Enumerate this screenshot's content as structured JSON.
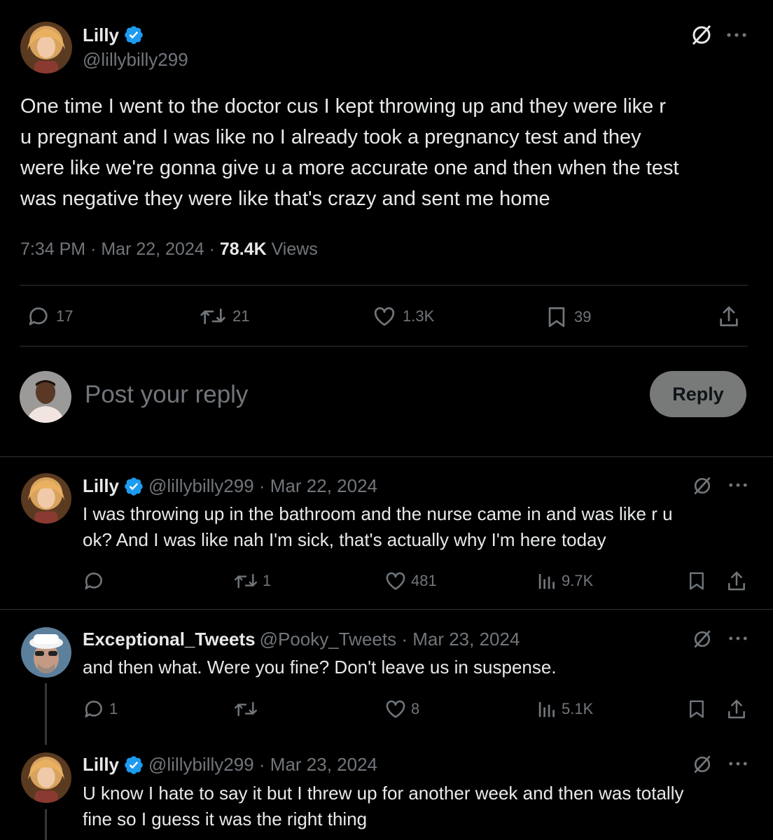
{
  "main_post": {
    "author_name": "Lilly",
    "author_handle": "@lillybilly299",
    "text_lines": [
      "One time I went to the doctor cus I kept throwing up and they were like r",
      "u pregnant and I was like no I already took a pregnancy test and they",
      "were like we're gonna give u a more accurate one and then when the test",
      "was negative they were like that's crazy and sent me home"
    ],
    "time": "7:34 PM",
    "separator": "·",
    "date": "Mar 22, 2024",
    "views_count": "78.4K",
    "views_label": "Views",
    "stats": {
      "replies": "17",
      "reposts": "21",
      "likes": "1.3K",
      "bookmarks": "39"
    }
  },
  "composer": {
    "placeholder": "Post your reply",
    "reply_button": "Reply"
  },
  "replies": [
    {
      "author_name": "Lilly",
      "handle_date": "@lillybilly299 · Mar 22, 2024",
      "text_lines": [
        "I was throwing up in the bathroom and the nurse came in and was like r u",
        "ok? And I was like nah I'm sick, that's actually why I'm here today"
      ],
      "replies": "",
      "reposts": "1",
      "likes": "481",
      "views": "9.7K"
    },
    {
      "author_name": "Exceptional_Tweets",
      "handle_date": "@Pooky_Tweets · Mar 23, 2024",
      "text_lines": [
        "and then what. Were you fine? Don't leave us in suspense."
      ],
      "replies": "1",
      "reposts": "",
      "likes": "8",
      "views": "5.1K"
    },
    {
      "author_name": "Lilly",
      "handle_date": "@lillybilly299 · Mar 23, 2024",
      "text_lines": [
        "U know I hate to say it but I threw up for another week and then was totally",
        "fine so I guess it was the right thing"
      ]
    }
  ],
  "icons": {
    "verified": "verified-badge-icon",
    "grok": "grok-icon",
    "more": "more-icon",
    "reply": "reply-icon",
    "repost": "repost-icon",
    "like": "heart-icon",
    "bookmark": "bookmark-icon",
    "share": "share-icon",
    "views": "views-icon"
  },
  "colors": {
    "background": "#000000",
    "text": "#e7e9ea",
    "muted": "#71767b",
    "verified": "#1d9bf0",
    "divider": "#2f3336",
    "reply_button_bg": "#787a7a"
  }
}
